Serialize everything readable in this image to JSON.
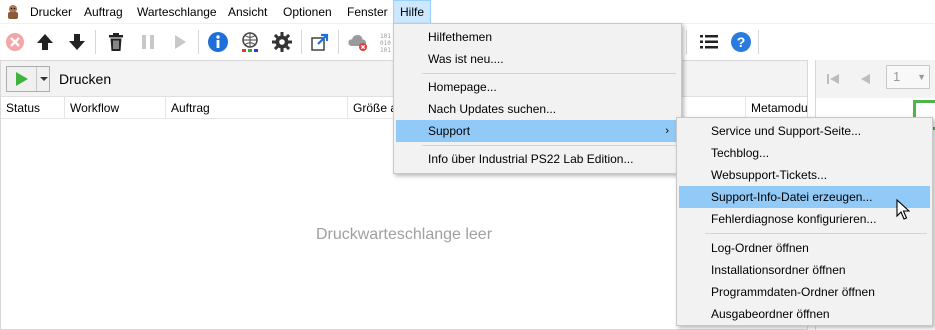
{
  "menubar": {
    "items": [
      "Drucker",
      "Auftrag",
      "Warteschlange",
      "Ansicht",
      "Optionen",
      "Fenster",
      "Hilfe"
    ]
  },
  "toolbar": {
    "icons": [
      "cancel-icon",
      "move-up-icon",
      "move-down-icon",
      "delete-icon",
      "pause-icon",
      "play-icon",
      "info-icon",
      "network-icon",
      "settings-icon",
      "external-link-icon",
      "cloud-error-icon",
      "binary-icon",
      "list-icon",
      "help-icon"
    ]
  },
  "queue_panel": {
    "title": "Drucken",
    "columns": [
      "Status",
      "Workflow",
      "Auftrag",
      "Größe a",
      "Metamodu"
    ],
    "empty_message": "Druckwarteschlange leer"
  },
  "preview_panel": {
    "page_value": "1"
  },
  "help_menu": {
    "items": [
      "Hilfethemen",
      "Was ist neu....",
      "Homepage...",
      "Nach Updates suchen...",
      "Support",
      "Info über Industrial PS22 Lab Edition..."
    ]
  },
  "support_submenu": {
    "items": [
      "Service und Support-Seite...",
      "Techblog...",
      "Websupport-Tickets...",
      "Support-Info-Datei erzeugen...",
      "Fehlerdiagnose konfigurieren...",
      "Log-Ordner öffnen",
      "Installationsordner öffnen",
      "Programmdaten-Ordner öffnen",
      "Ausgabeordner öffnen"
    ]
  },
  "colors": {
    "menu_highlight": "#91c9f7",
    "menubar_open": "#cce8ff",
    "play_green": "#3fb33b",
    "info_blue": "#1e6fd9",
    "help_blue": "#2a7be0"
  }
}
